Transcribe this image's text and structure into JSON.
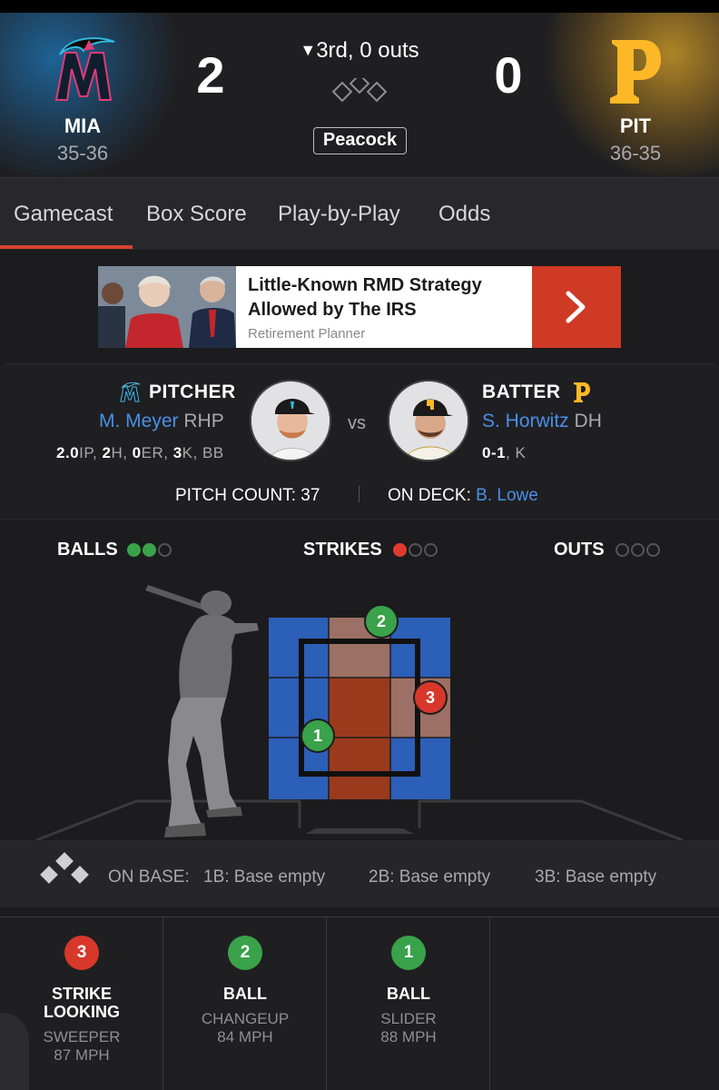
{
  "game": {
    "away": {
      "abbr": "MIA",
      "record": "35-36",
      "score": "2",
      "color": "#1b75a5"
    },
    "home": {
      "abbr": "PIT",
      "record": "36-35",
      "score": "0",
      "color": "#fdb827"
    },
    "inning": "3rd, 0 outs",
    "inning_arrow": "▼",
    "broadcast": "Peacock"
  },
  "tabs": [
    {
      "label": "Gamecast",
      "active": true
    },
    {
      "label": "Box Score"
    },
    {
      "label": "Play-by-Play"
    },
    {
      "label": "Odds"
    }
  ],
  "ad": {
    "title": "Little-Known RMD Strategy Allowed by The IRS",
    "sponsor": "Retirement Planner",
    "cta_icon": "chevron-right-icon"
  },
  "matchup": {
    "pitcher": {
      "role": "PITCHER",
      "name": "M. Meyer",
      "pos": "RHP",
      "stats": {
        "ip": "2.0",
        "h": "2",
        "er": "0",
        "k": "3",
        "bb": "BB"
      }
    },
    "batter": {
      "role": "BATTER",
      "name": "S. Horwitz",
      "pos": "DH",
      "line": "0-1",
      "extra": "K"
    },
    "vs": "vs",
    "pitch_count_label": "PITCH COUNT:",
    "pitch_count": "37",
    "on_deck_label": "ON DECK:",
    "on_deck": "B. Lowe"
  },
  "count": {
    "balls_label": "BALLS",
    "balls": 2,
    "balls_max": 4,
    "strikes_label": "STRIKES",
    "strikes": 1,
    "strikes_max": 3,
    "outs_label": "OUTS",
    "outs": 0,
    "outs_max": 3
  },
  "pitches": [
    {
      "num": "1",
      "result": "BALL",
      "result_line2": "",
      "type": "SLIDER",
      "speed": "88 MPH",
      "color": "#3aa24a",
      "zone_x": 0.27,
      "zone_y": 0.65
    },
    {
      "num": "2",
      "result": "BALL",
      "result_line2": "",
      "type": "CHANGEUP",
      "speed": "84 MPH",
      "color": "#3aa24a",
      "zone_x": 0.62,
      "zone_y": 0.02
    },
    {
      "num": "3",
      "result": "STRIKE",
      "result_line2": "LOOKING",
      "type": "SWEEPER",
      "speed": "87 MPH",
      "color": "#d7382a",
      "zone_x": 0.89,
      "zone_y": 0.44
    }
  ],
  "on_base": {
    "label": "ON BASE:",
    "first": "1B: Base empty",
    "second": "2B: Base empty",
    "third": "3B: Base empty"
  },
  "colors": {
    "accent": "#d5442f",
    "link": "#4a8fe7",
    "zone_cold": "#2c5fb8",
    "zone_warm": "#9c7064",
    "zone_hot": "#9a3a1c"
  }
}
